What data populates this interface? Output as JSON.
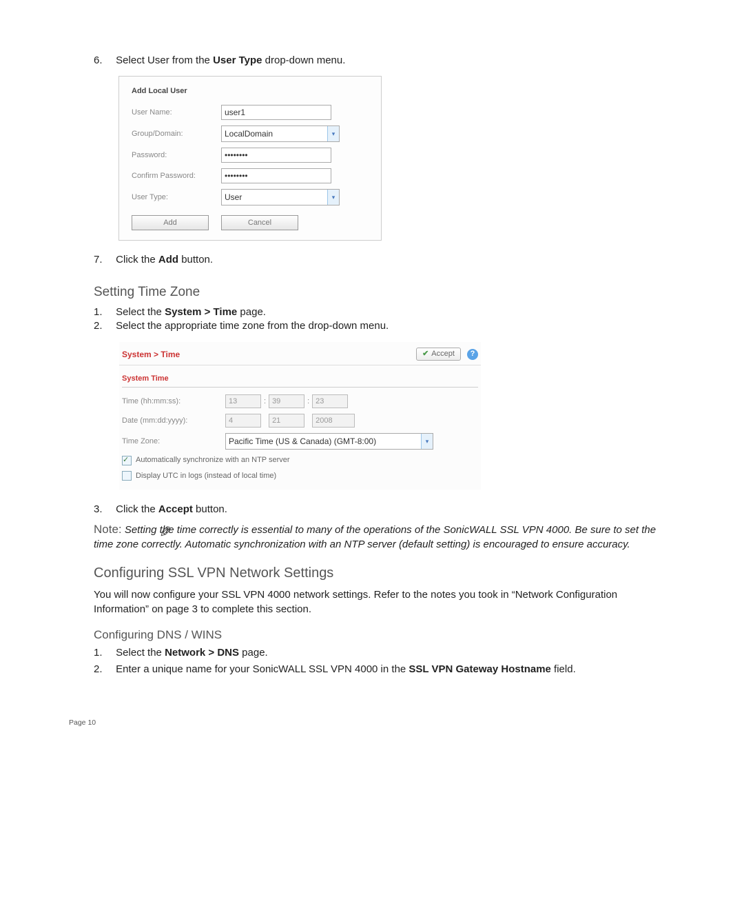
{
  "step6": {
    "num": "6.",
    "text_before": "Select User from the ",
    "bold": "User Type",
    "text_after": " drop-down menu."
  },
  "add_user": {
    "title": "Add Local User",
    "fields": {
      "user_name_label": "User Name:",
      "user_name_value": "user1",
      "group_label": "Group/Domain:",
      "group_value": "LocalDomain",
      "password_label": "Password:",
      "password_value": "••••••••",
      "confirm_label": "Confirm Password:",
      "confirm_value": "••••••••",
      "user_type_label": "User Type:",
      "user_type_value": "User"
    },
    "buttons": {
      "add": "Add",
      "cancel": "Cancel"
    }
  },
  "step7": {
    "num": "7.",
    "text_before": "Click the ",
    "bold": "Add",
    "text_after": " button."
  },
  "heading_timezone": "Setting Time Zone",
  "tz_step1": {
    "num": "1.",
    "text_before": "Select the ",
    "bold": "System > Time",
    "text_after": " page."
  },
  "tz_step2": {
    "num": "2.",
    "text": "Select the appropriate time zone from the drop-down menu."
  },
  "system_time": {
    "breadcrumb": "System > Time",
    "accept_btn": "Accept",
    "section_title": "System Time",
    "time_label": "Time (hh:mm:ss):",
    "time_hh": "13",
    "time_mm": "39",
    "time_ss": "23",
    "date_label": "Date (mm:dd:yyyy):",
    "date_mm": "4",
    "date_dd": "21",
    "date_yyyy": "2008",
    "zone_label": "Time Zone:",
    "zone_value": "Pacific Time (US & Canada) (GMT-8:00)",
    "cb1_label": "Automatically synchronize with an NTP server",
    "cb2_label": "Display UTC in logs (instead of local time)"
  },
  "tz_step3": {
    "num": "3.",
    "text_before": "Click the ",
    "bold": "Accept",
    "text_after": " button."
  },
  "note": {
    "label": "Note:",
    "body": "Setting the time correctly is essential to many of the operations of the SonicWALL SSL VPN 4000. Be sure to set the time zone correctly. Automatic synchronization with an NTP server (default setting) is encouraged to ensure accuracy."
  },
  "heading_ssl": "Configuring SSL VPN Network Settings",
  "ssl_para": "You will now configure your SSL VPN 4000 network settings. Refer to the notes you took in “Network Configuration Information” on page 3 to complete this section.",
  "heading_dns": "Configuring DNS / WINS",
  "dns_step1": {
    "num": "1.",
    "text_before": "Select the ",
    "bold": "Network > DNS",
    "text_after": " page."
  },
  "dns_step2": {
    "num": "2.",
    "text_before": "Enter a unique name for your SonicWALL SSL VPN 4000 in the ",
    "bold": "SSL VPN Gateway Hostname",
    "text_after": " field."
  },
  "page_footer": "Page 10"
}
